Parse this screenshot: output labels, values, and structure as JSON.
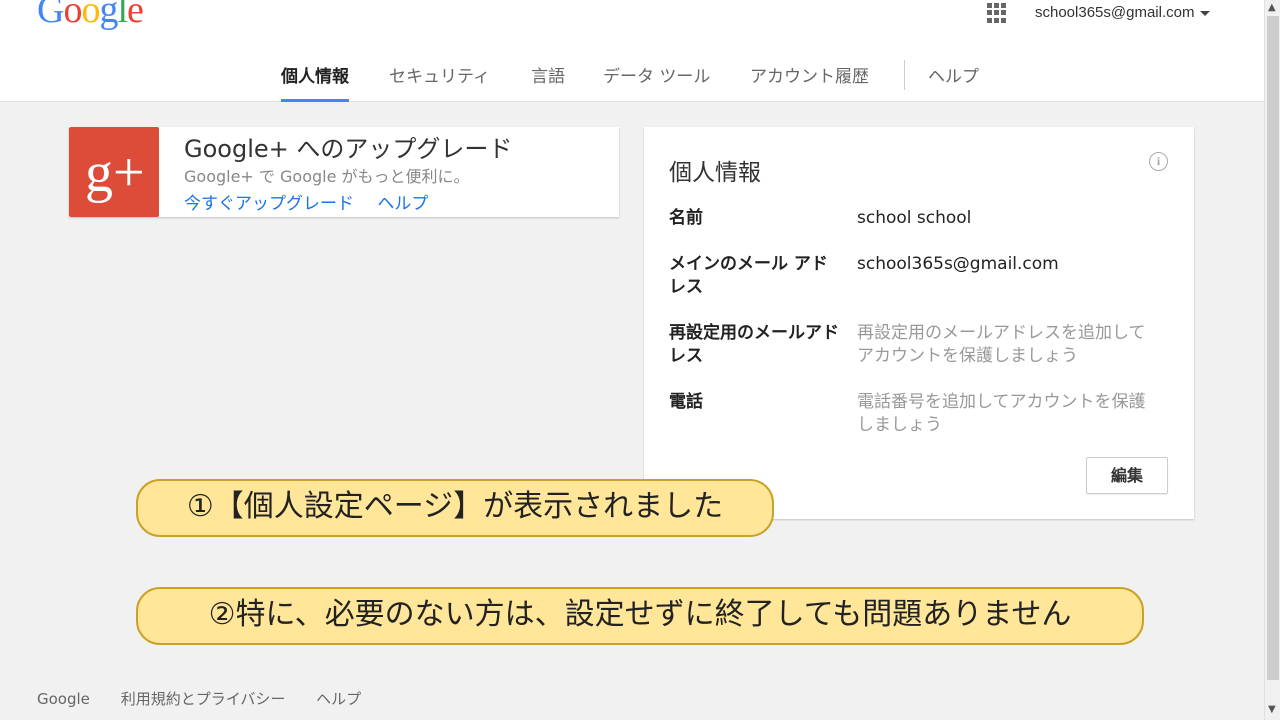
{
  "logo": {
    "text": "Google"
  },
  "account": {
    "email": "school365s@gmail.com"
  },
  "nav": {
    "tabs": [
      {
        "label": "個人情報",
        "active": true
      },
      {
        "label": "セキュリティ"
      },
      {
        "label": "言語"
      },
      {
        "label": "データ ツール"
      },
      {
        "label": "アカウント履歴"
      },
      {
        "label": "ヘルプ"
      }
    ]
  },
  "gplus": {
    "logo_text": "g+",
    "title": "Google+ へのアップグレード",
    "subtitle": "Google+ で Google がもっと便利に。",
    "upgrade_link": "今すぐアップグレード",
    "help_link": "ヘルプ"
  },
  "personal_info": {
    "title": "個人情報",
    "fields": [
      {
        "label": "名前",
        "value": "school school"
      },
      {
        "label": "メインのメール アドレス",
        "value": "school365s@gmail.com"
      },
      {
        "label": "再設定用のメールアドレス",
        "value": "再設定用のメールアドレスを追加してアカウントを保護しましょう"
      },
      {
        "label": "電話",
        "value": "電話番号を追加してアカウントを保護しましょう"
      }
    ],
    "edit_label": "編集"
  },
  "callouts": {
    "first": "①【個人設定ページ】が表示されました",
    "second": "②特に、必要のない方は、設定せずに終了しても問題ありません"
  },
  "footer": {
    "google": "Google",
    "terms": "利用規約とプライバシー",
    "help": "ヘルプ"
  },
  "colors": {
    "accent_blue": "#4285f4",
    "gplus_red": "#dd4b39",
    "callout_fill": "#ffe699"
  }
}
